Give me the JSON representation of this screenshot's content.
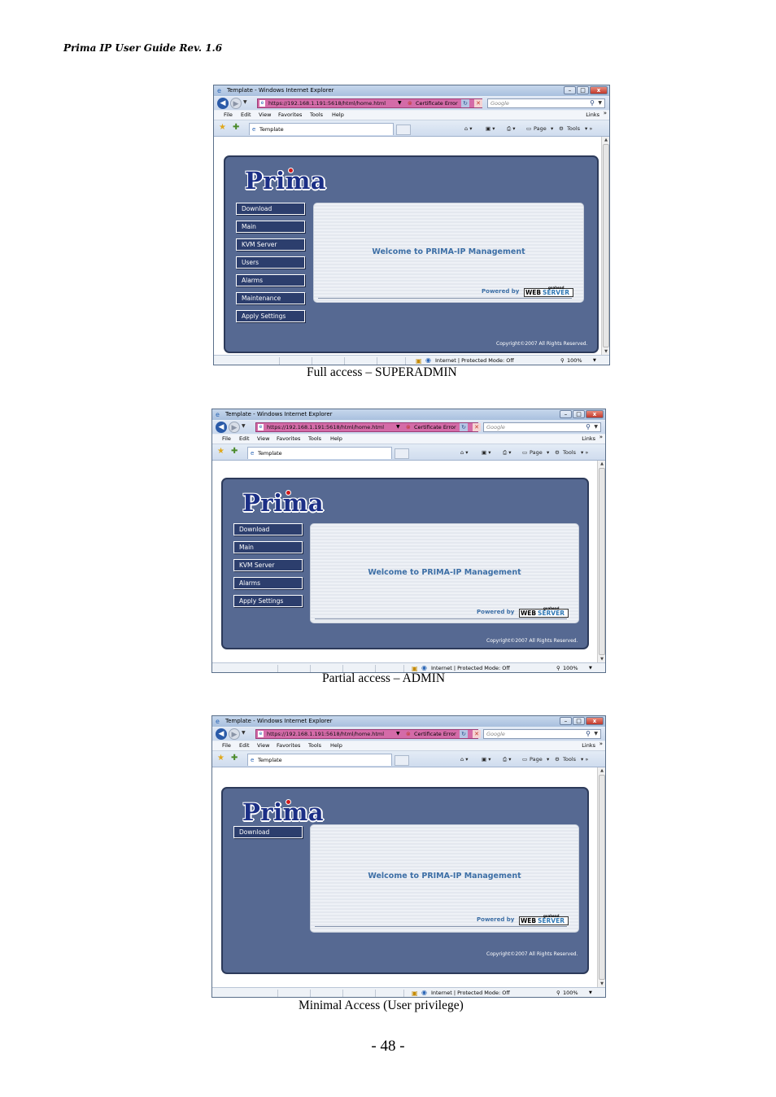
{
  "document": {
    "header": "Prima IP User Guide Rev. 1.6",
    "page_number": "- 48 -"
  },
  "browser": {
    "window_title": "Template - Windows Internet Explorer",
    "url": "https://192.168.1.191:5618/html/home.html",
    "certificate_error": "Certificate Error",
    "search_placeholder": "Google",
    "menu": [
      "File",
      "Edit",
      "View",
      "Favorites",
      "Tools",
      "Help"
    ],
    "links_label": "Links",
    "tab_title": "Template",
    "page_label": "Page",
    "tools_label": "Tools",
    "status_zone": "Internet | Protected Mode: Off",
    "zoom": "100%"
  },
  "prima": {
    "logo": "Prima",
    "welcome": "Welcome to PRIMA-IP Management",
    "powered_by": "Powered by",
    "webserver_web": "WEB",
    "webserver_server": "SERVER",
    "webserver_goahead": "goahead",
    "copyright": "Copyright©2007  All Rights Reserved."
  },
  "screens": [
    {
      "caption": "Full access – SUPERADMIN",
      "menu": [
        "Download",
        "Main",
        "KVM Server",
        "Users",
        "Alarms",
        "Maintenance",
        "Apply Settings"
      ]
    },
    {
      "caption": "Partial access – ADMIN",
      "menu": [
        "Download",
        "Main",
        "KVM Server",
        "Alarms",
        "Apply Settings"
      ]
    },
    {
      "caption": "Minimal Access (User privilege)",
      "menu": [
        "Download"
      ]
    }
  ],
  "colors": {
    "panel": "#566992",
    "menu_button": "#2c3e6d",
    "url_bar_cert_error": "#d46ba8",
    "welcome_text": "#3d6fa6"
  }
}
